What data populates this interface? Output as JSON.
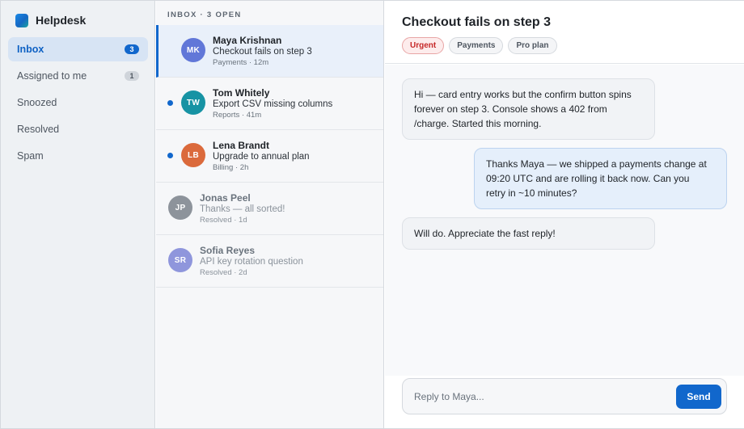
{
  "app": {
    "name": "Helpdesk",
    "logo_icon": "helpdesk-logo-icon"
  },
  "sidebar": {
    "items": [
      {
        "label": "Inbox",
        "count": "3",
        "active": true
      },
      {
        "label": "Assigned to me",
        "count": "1",
        "active": false
      },
      {
        "label": "Snoozed",
        "count": null,
        "active": false
      },
      {
        "label": "Resolved",
        "count": null,
        "active": false
      },
      {
        "label": "Spam",
        "count": null,
        "active": false
      }
    ]
  },
  "list": {
    "header": "INBOX · 3 OPEN",
    "conversations": [
      {
        "initials": "MK",
        "name": "Maya Krishnan",
        "subject": "Checkout fails on step 3",
        "meta": "Payments · 12m",
        "avatar_color": "#6177d8",
        "unread": false,
        "selected": true,
        "dim": false
      },
      {
        "initials": "TW",
        "name": "Tom Whitely",
        "subject": "Export CSV missing columns",
        "meta": "Reports · 41m",
        "avatar_color": "#1793a4",
        "unread": true,
        "selected": false,
        "dim": false
      },
      {
        "initials": "LB",
        "name": "Lena Brandt",
        "subject": "Upgrade to annual plan",
        "meta": "Billing · 2h",
        "avatar_color": "#db6a3c",
        "unread": true,
        "selected": false,
        "dim": false
      },
      {
        "initials": "JP",
        "name": "Jonas Peel",
        "subject": "Thanks — all sorted!",
        "meta": "Resolved · 1d",
        "avatar_color": "#8d939b",
        "unread": false,
        "selected": false,
        "dim": true
      },
      {
        "initials": "SR",
        "name": "Sofia Reyes",
        "subject": "API key rotation question",
        "meta": "Resolved · 2d",
        "avatar_color": "#8f96dc",
        "unread": false,
        "selected": false,
        "dim": true
      }
    ]
  },
  "thread": {
    "title": "Checkout fails on step 3",
    "tags": [
      {
        "label": "Urgent",
        "style": "urgent"
      },
      {
        "label": "Payments",
        "style": "neutral"
      },
      {
        "label": "Pro plan",
        "style": "neutral"
      }
    ],
    "messages": [
      {
        "direction": "in",
        "lines": [
          "Hi — card entry works but the confirm button spins",
          "forever on step 3. Console shows a 402 from",
          "/charge. Started this morning."
        ]
      },
      {
        "direction": "out",
        "lines": [
          "Thanks Maya — we shipped a payments change at",
          "09:20 UTC and are rolling it back now. Can you",
          "retry in ~10 minutes?"
        ]
      },
      {
        "direction": "in",
        "lines": [
          "Will do. Appreciate the fast reply!"
        ]
      }
    ]
  },
  "composer": {
    "placeholder": "Reply to Maya...",
    "value": "",
    "send_label": "Send"
  },
  "colors": {
    "accent": "#1167cc",
    "urgent": "#c62828"
  }
}
